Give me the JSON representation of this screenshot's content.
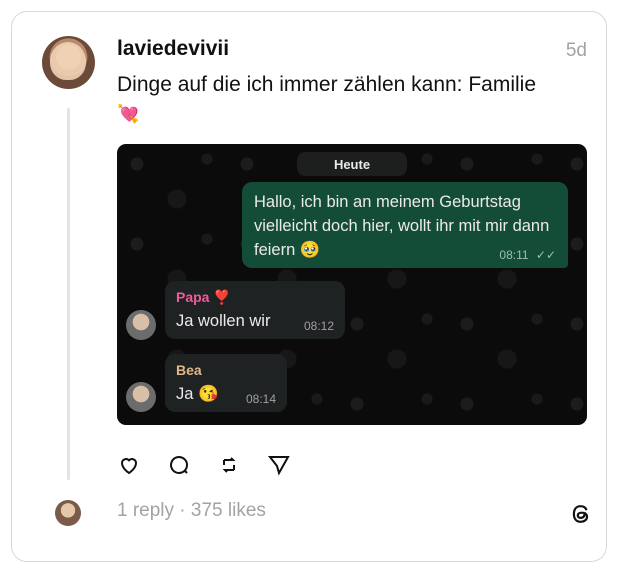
{
  "post": {
    "username": "laviedevivii",
    "time": "5d",
    "text_line1": "Dinge auf die ich immer zählen kann: Familie",
    "text_emoji": "💘"
  },
  "chat": {
    "date_label": "Heute",
    "outgoing": {
      "text": "Hallo, ich bin an meinem Geburtstag vielleicht doch hier, wollt ihr mit mir dann feiern",
      "emoji": "🥹",
      "time": "08:11",
      "ticks": "✓✓"
    },
    "messages": [
      {
        "sender": "Papa",
        "sender_emoji": "❣️",
        "text": "Ja wollen wir",
        "time": "08:12",
        "sender_color": "#ee5d9a"
      },
      {
        "sender": "Bea",
        "text": "Ja",
        "emoji": "😘",
        "time": "08:14",
        "sender_color": "#e2b58b"
      }
    ]
  },
  "actions": [
    "heart-icon",
    "comment-icon",
    "repost-icon",
    "share-icon"
  ],
  "footer": {
    "stats": "1 reply · 375 likes"
  },
  "colors": {
    "bubble_out": "#144d37",
    "bubble_in": "#1f2222",
    "chat_bg": "#0b0b0b",
    "muted": "#a3a3a3"
  }
}
